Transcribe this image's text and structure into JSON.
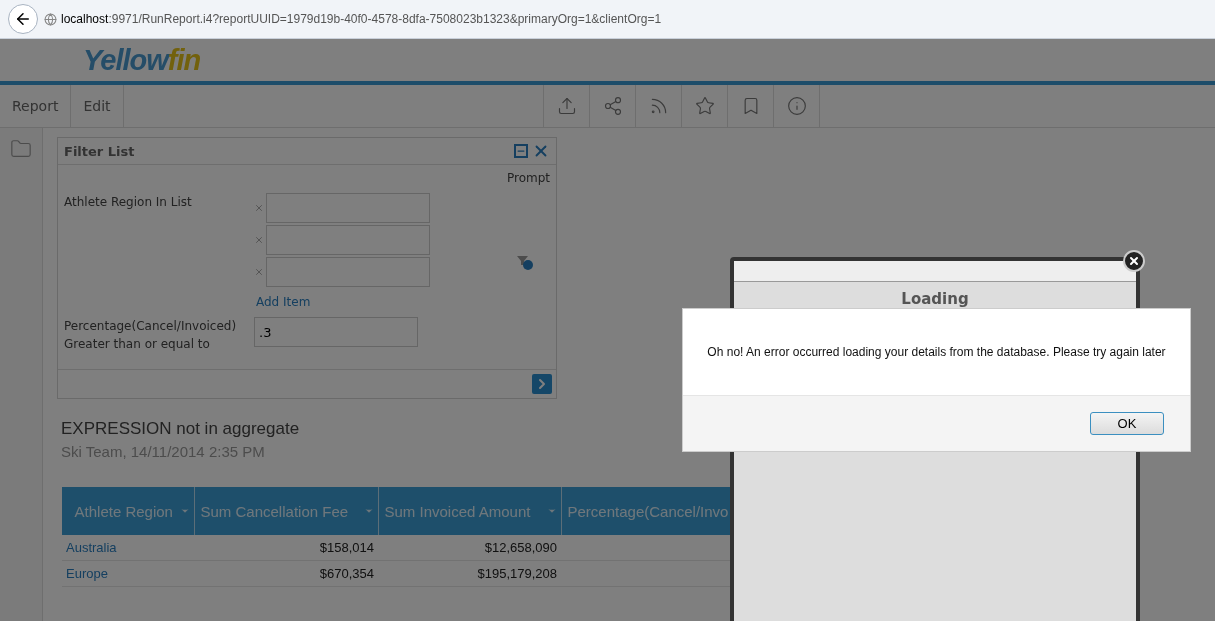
{
  "browser": {
    "url_host": "localhost",
    "url_path": ":9971/RunReport.i4?reportUUID=1979d19b-40f0-4578-8dfa-7508023b1323&primaryOrg=1&clientOrg=1"
  },
  "header": {
    "logo": {
      "main": "Yellow",
      "accent": "fin"
    }
  },
  "menu": [
    {
      "label": "Report"
    },
    {
      "label": "Edit"
    }
  ],
  "toolbar": [
    {
      "kind": "upload"
    },
    {
      "kind": "share"
    },
    {
      "kind": "rss"
    },
    {
      "kind": "star"
    },
    {
      "kind": "bookmark"
    },
    {
      "kind": "info"
    }
  ],
  "filter_panel": {
    "title": "Filter List",
    "prompt_label": "Prompt",
    "filters": [
      {
        "kind": "list",
        "label": "Athlete Region In List",
        "entries": [
          {
            "removable": true
          },
          {
            "removable": true
          },
          {
            "removable": true
          }
        ],
        "add_link": "Add Item"
      },
      {
        "kind": "value",
        "label": "Percentage(Cancel/Invoiced) Greater than or equal to",
        "value": ".3"
      }
    ]
  },
  "report": {
    "title": "EXPRESSION not in aggregate",
    "subtitle": "Ski Team, 14/11/2014 2:35 PM",
    "table": {
      "columns": [
        {
          "label": "Athlete Region",
          "sortable": true
        },
        {
          "label": "Sum Cancellation Fee",
          "sortable": true
        },
        {
          "label": "Sum Invoiced Amount",
          "sortable": true
        },
        {
          "label": "Percentage(Cancel/Invo",
          "sortable": false
        }
      ],
      "rows": [
        {
          "cells": [
            "Australia",
            "$158,014",
            "$12,658,090"
          ]
        },
        {
          "cells": [
            "Europe",
            "$670,354",
            "$195,179,208"
          ]
        }
      ]
    }
  },
  "loading_dialog": {
    "title": "Loading"
  },
  "alert": {
    "message": "Oh no! An error occurred loading your details from the database. Please try again later",
    "button": "OK"
  }
}
